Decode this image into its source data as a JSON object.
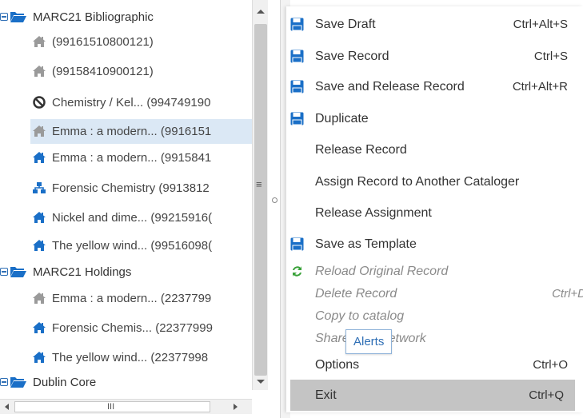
{
  "colors": {
    "accent": "#1a6fc7",
    "grey_icon": "#9a9a9a",
    "selected_bg": "#dbe8f5",
    "active_menu": "#c4c4c4",
    "reload_green": "#3aa23a"
  },
  "tree": {
    "groups": [
      {
        "label": "MARC21 Bibliographic",
        "items": [
          {
            "label": "(99161510800121)",
            "icon": "house-grey-icon"
          },
          {
            "label": "(99158410900121)",
            "icon": "house-grey-icon"
          },
          {
            "label": "Chemistry / Kel... (994749190",
            "icon": "prohibited-icon"
          },
          {
            "label": "Emma : a modern... (9916151",
            "icon": "house-grey-icon"
          },
          {
            "label": "Emma : a modern... (9915841",
            "icon": "house-blue-icon"
          },
          {
            "label": "Forensic Chemistry (9913812",
            "icon": "network-icon"
          },
          {
            "label": "Nickel and dime... (99215916(",
            "icon": "house-blue-icon"
          },
          {
            "label": "The yellow wind... (99516098(",
            "icon": "house-blue-icon"
          }
        ]
      },
      {
        "label": "MARC21 Holdings",
        "items": [
          {
            "label": "Emma : a modern... (2237799",
            "icon": "house-grey-icon"
          },
          {
            "label": "Forensic Chemis... (22377999",
            "icon": "house-blue-icon"
          },
          {
            "label": "The yellow wind... (22377998",
            "icon": "house-blue-icon"
          }
        ]
      },
      {
        "label": "Dublin Core",
        "items": []
      }
    ]
  },
  "scrollbar": {
    "h_grip": "III",
    "v_grip": "≡"
  },
  "menu": {
    "items": [
      {
        "label": "Save Draft",
        "shortcut": "Ctrl+Alt+S",
        "icon": "floppy-disk-icon"
      },
      {
        "label": "Save Record",
        "shortcut": "Ctrl+S",
        "icon": "floppy-disk-icon"
      },
      {
        "label": "Save and Release Record",
        "shortcut": "Ctrl+Alt+R",
        "icon": "floppy-disk-icon"
      },
      {
        "label": "Duplicate",
        "shortcut": "",
        "icon": "floppy-disk-icon"
      },
      {
        "label": "Release Record",
        "shortcut": ""
      },
      {
        "label": "Assign Record to Another Cataloger",
        "shortcut": ""
      },
      {
        "label": "Release Assignment",
        "shortcut": ""
      },
      {
        "label": "Save as Template",
        "shortcut": "",
        "icon": "floppy-disk-icon"
      },
      {
        "label": "Reload Original Record",
        "shortcut": "",
        "icon": "reload-icon",
        "disabled": true
      },
      {
        "label": "Delete Record",
        "shortcut": "Ctrl+D",
        "disabled": true
      },
      {
        "label": "Copy to catalog",
        "shortcut": "",
        "disabled": true
      },
      {
        "label": "Share with Network",
        "shortcut": "",
        "disabled": true
      },
      {
        "label": "Options",
        "shortcut": "Ctrl+O"
      },
      {
        "label": "Exit",
        "shortcut": "Ctrl+Q",
        "active": true
      }
    ]
  },
  "tooltip": {
    "text": "Alerts"
  }
}
